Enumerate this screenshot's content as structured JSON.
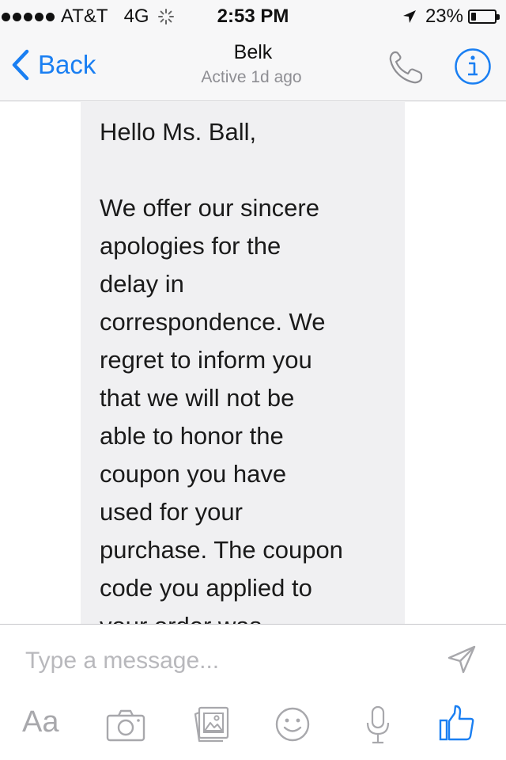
{
  "status_bar": {
    "carrier": "AT&T",
    "network": "4G",
    "time": "2:53 PM",
    "battery_percent": "23%",
    "battery_level": 0.23
  },
  "nav": {
    "back_label": "Back",
    "title": "Belk",
    "subtitle": "Active 1d ago"
  },
  "message": {
    "greeting": "Hello Ms. Ball,",
    "body": "We offer our sincere\napologies for the\ndelay in\ncorrespondence. We\nregret to inform you\nthat we will not be\nable to honor the\ncoupon you have\nused for your\npurchase. The coupon\ncode you applied to\nyour order was"
  },
  "composer": {
    "placeholder": "Type a message...",
    "text_tool_label": "Aa"
  },
  "colors": {
    "accent": "#1a7ff2",
    "icon_gray": "#a8a8ac",
    "bubble": "#f0f0f2"
  },
  "icons": [
    "activity-spinner-icon",
    "location-arrow-icon",
    "battery-icon",
    "chevron-left-icon",
    "phone-icon",
    "info-icon",
    "send-icon",
    "camera-icon",
    "gallery-icon",
    "emoji-icon",
    "microphone-icon",
    "like-icon"
  ]
}
